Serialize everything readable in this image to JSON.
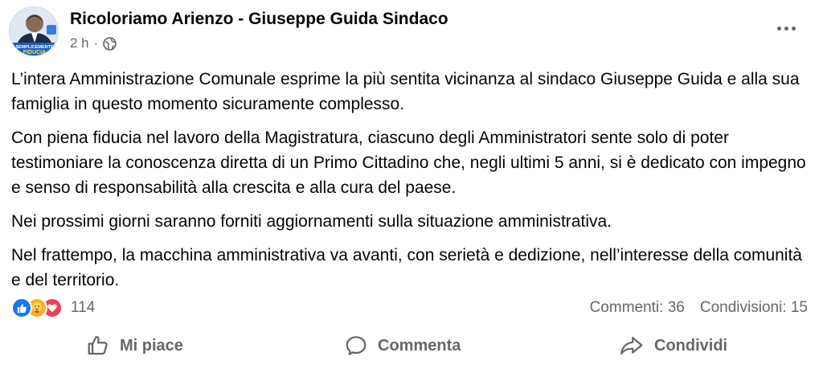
{
  "post": {
    "author": "Ricoloriamo Arienzo - Giuseppe Guida Sindaco",
    "time": "2 h",
    "separator": "·",
    "avatar_banner_line1": "SEMPLICEMENTE",
    "avatar_banner_line2": "FIDUCIA",
    "paragraphs": [
      "L’intera Amministrazione Comunale esprime la più sentita vicinanza al sindaco Giuseppe Guida e alla sua famiglia in questo momento sicuramente complesso.",
      "Con piena fiducia nel lavoro della Magistratura, ciascuno degli Amministratori sente solo di poter testimoniare la conoscenza diretta di un Primo Cittadino che, negli ultimi 5 anni, si è dedicato con impegno e senso di responsabilità alla crescita e alla cura del paese.",
      "Nei prossimi giorni saranno forniti aggiornamenti sulla situazione amministrativa.",
      "Nel frattempo, la macchina amministrativa va avanti, con serietà e dedizione, nell’interesse della comunità e del territorio."
    ]
  },
  "reactions": {
    "count": "114",
    "types": [
      "like-icon",
      "care-icon",
      "love-icon"
    ],
    "colors": {
      "like": "#1877f2",
      "care": "#f7b125",
      "love": "#f33e58"
    }
  },
  "stats": {
    "comments": "Commenti: 36",
    "shares": "Condivisioni: 15"
  },
  "actions": {
    "like_label": "Mi piace",
    "comment_label": "Commenta",
    "share_label": "Condividi"
  }
}
